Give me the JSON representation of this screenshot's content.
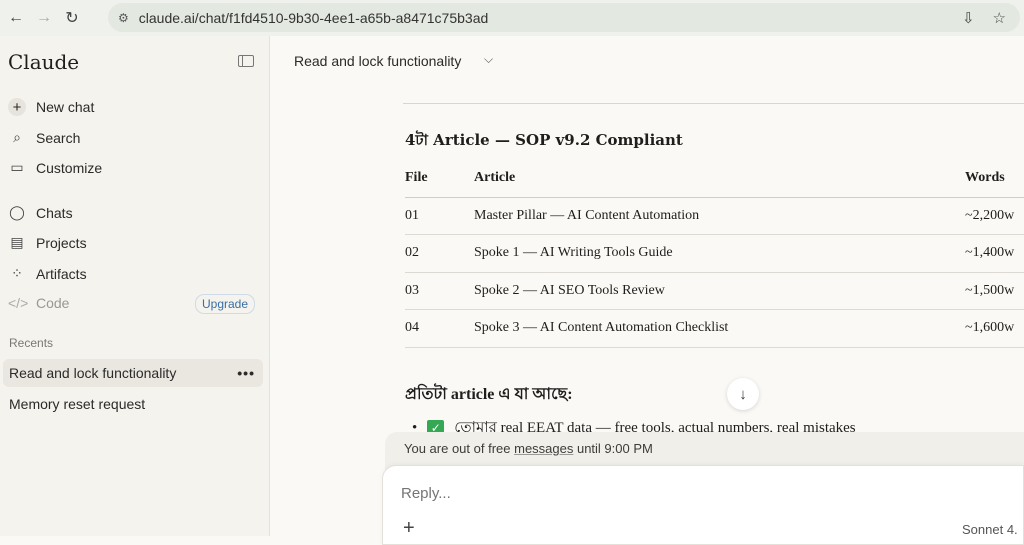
{
  "browser": {
    "url": "claude.ai/chat/f1fd4510-9b30-4ee1-a65b-a8471c75b3ad"
  },
  "sidebar": {
    "logo": "Claude",
    "items": [
      {
        "label": "New chat"
      },
      {
        "label": "Search"
      },
      {
        "label": "Customize"
      },
      {
        "label": "Chats"
      },
      {
        "label": "Projects"
      },
      {
        "label": "Artifacts"
      },
      {
        "label": "Code"
      }
    ],
    "upgrade": "Upgrade",
    "recents_label": "Recents",
    "recents": [
      "Read and lock functionality",
      "Memory reset request"
    ],
    "more": "•••"
  },
  "header": {
    "title": "Read and lock functionality"
  },
  "content": {
    "heading": "4টা Article — SOP v9.2 Compliant",
    "table": {
      "headers": [
        "File",
        "Article",
        "Words"
      ],
      "rows": [
        [
          "01",
          "Master Pillar — AI Content Automation",
          "~2,200w"
        ],
        [
          "02",
          "Spoke 1 — AI Writing Tools Guide",
          "~1,400w"
        ],
        [
          "03",
          "Spoke 2 — AI SEO Tools Review",
          "~1,500w"
        ],
        [
          "04",
          "Spoke 3 — AI Content Automation Checklist",
          "~1,600w"
        ]
      ]
    },
    "subheading": "প্রতিটা article এ যা আছে:",
    "bullet": "তোমার real EEAT data — free tools, actual numbers, real mistakes"
  },
  "limit": {
    "pre": "You are out of free ",
    "link": "messages",
    "post": " until 9:00 PM"
  },
  "composer": {
    "placeholder": "Reply...",
    "model": "Sonnet 4."
  }
}
